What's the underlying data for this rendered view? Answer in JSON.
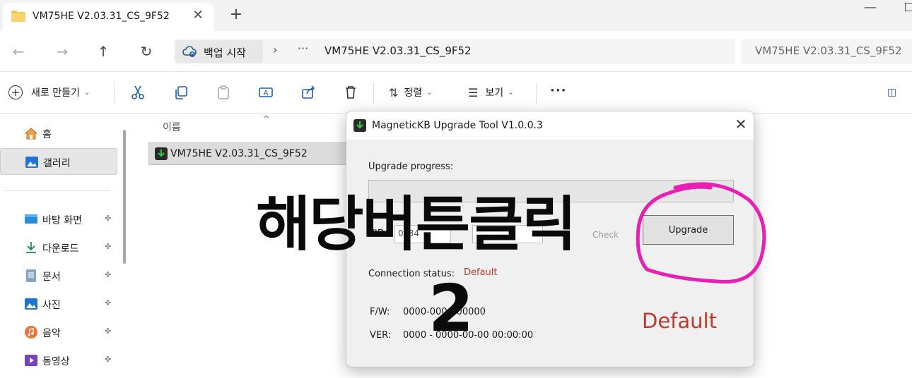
{
  "window": {
    "tab_title": "VM75HE V2.03.31_CS_9F52",
    "tab_close": "✕",
    "new_tab": "+",
    "minimize": "—"
  },
  "address": {
    "back": "←",
    "forward": "→",
    "up": "↑",
    "refresh": "↻",
    "backup_label": "백업 시작",
    "separator": "›",
    "overflow": "···",
    "path": "VM75HE V2.03.31_CS_9F52",
    "search_placeholder": "VM75HE V2.03.31_CS_9F52"
  },
  "commandbar": {
    "new_label": "새로 만들기",
    "chevron": "⌄",
    "sort_label": "정렬",
    "view_label": "보기",
    "more": "···",
    "icons": [
      "cut-icon",
      "copy-icon",
      "paste-icon",
      "rename-icon",
      "share-icon",
      "delete-icon"
    ]
  },
  "sidebar": {
    "items": [
      {
        "label": "홈",
        "icon": "home-icon"
      },
      {
        "label": "갤러리",
        "icon": "gallery-icon"
      },
      {
        "label": "바탕 화면",
        "icon": "desktop-icon",
        "pinned": true
      },
      {
        "label": "다운로드",
        "icon": "download-icon",
        "pinned": true
      },
      {
        "label": "문서",
        "icon": "document-icon",
        "pinned": true
      },
      {
        "label": "사진",
        "icon": "pictures-icon",
        "pinned": true
      },
      {
        "label": "음악",
        "icon": "music-icon",
        "pinned": true
      },
      {
        "label": "동영상",
        "icon": "video-icon",
        "pinned": true
      }
    ],
    "pin_glyph": "📌"
  },
  "filelist": {
    "column_name": "이름",
    "sort_caret": "^",
    "rows": [
      {
        "name": "VM75HE V2.03.31_CS_9F52",
        "icon": "app-icon"
      }
    ]
  },
  "dialog": {
    "title": "MagneticKB Upgrade Tool V1.0.0.3",
    "close": "✕",
    "progress_label": "Upgrade progress:",
    "progress_value": 0,
    "upgrade_button": "Upgrade",
    "vid_label": "VID:",
    "vid_value": "0x34",
    "check_label": "Check",
    "connection_label": "Connection status:",
    "connection_value": "Default",
    "fw_label": "F/W:",
    "fw_value": "0000-000-000000",
    "ver_label": "VER:",
    "ver_value": "0000 - 0000-00-00 00:00:00",
    "status_big": "Default"
  },
  "annotation": {
    "text": "해당버튼클릭",
    "step": "2",
    "circle_color": "#e91eb5"
  },
  "colors": {
    "accent": "#1e5fa8",
    "progress_green": "#06b025",
    "status_red": "#c0392b"
  }
}
